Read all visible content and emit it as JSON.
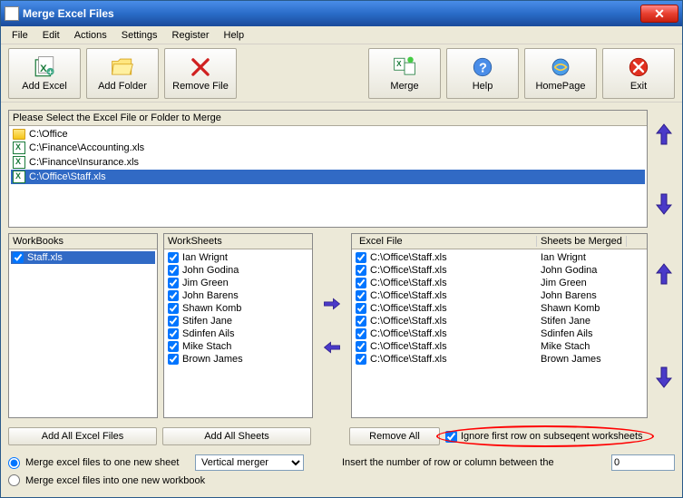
{
  "window": {
    "title": "Merge Excel Files"
  },
  "menu": [
    "File",
    "Edit",
    "Actions",
    "Settings",
    "Register",
    "Help"
  ],
  "toolbar": [
    {
      "id": "add-excel",
      "label": "Add Excel"
    },
    {
      "id": "add-folder",
      "label": "Add Folder"
    },
    {
      "id": "remove-file",
      "label": "Remove File"
    },
    {
      "id": "merge",
      "label": "Merge"
    },
    {
      "id": "help",
      "label": "Help"
    },
    {
      "id": "homepage",
      "label": "HomePage"
    },
    {
      "id": "exit",
      "label": "Exit"
    }
  ],
  "files_panel": {
    "header": "Please Select the Excel File or Folder to Merge",
    "items": [
      {
        "type": "folder",
        "path": "C:\\Office"
      },
      {
        "type": "excel",
        "path": "C:\\Finance\\Accounting.xls"
      },
      {
        "type": "excel",
        "path": "C:\\Finance\\Insurance.xls"
      },
      {
        "type": "excel",
        "path": "C:\\Office\\Staff.xls",
        "selected": true
      }
    ]
  },
  "workbooks": {
    "header": "WorkBooks",
    "items": [
      {
        "name": "Staff.xls",
        "checked": true,
        "selected": true
      }
    ]
  },
  "worksheets": {
    "header": "WorkSheets",
    "items": [
      {
        "name": "Ian Wrignt",
        "checked": true
      },
      {
        "name": "John Godina",
        "checked": true
      },
      {
        "name": "Jim Green",
        "checked": true
      },
      {
        "name": "John Barens",
        "checked": true
      },
      {
        "name": "Shawn Komb",
        "checked": true
      },
      {
        "name": "Stifen Jane",
        "checked": true
      },
      {
        "name": "Sdinfen Ails",
        "checked": true
      },
      {
        "name": "Mike Stach",
        "checked": true
      },
      {
        "name": "Brown James",
        "checked": true
      }
    ]
  },
  "merge_list": {
    "header_file": "Excel File",
    "header_sheets": "Sheets be Merged",
    "rows": [
      {
        "file": "C:\\Office\\Staff.xls",
        "sheet": "Ian Wrignt"
      },
      {
        "file": "C:\\Office\\Staff.xls",
        "sheet": "John Godina"
      },
      {
        "file": "C:\\Office\\Staff.xls",
        "sheet": "Jim Green"
      },
      {
        "file": "C:\\Office\\Staff.xls",
        "sheet": "John Barens"
      },
      {
        "file": "C:\\Office\\Staff.xls",
        "sheet": "Shawn Komb"
      },
      {
        "file": "C:\\Office\\Staff.xls",
        "sheet": "Stifen Jane"
      },
      {
        "file": "C:\\Office\\Staff.xls",
        "sheet": "Sdinfen Ails"
      },
      {
        "file": "C:\\Office\\Staff.xls",
        "sheet": "Mike Stach"
      },
      {
        "file": "C:\\Office\\Staff.xls",
        "sheet": "Brown James"
      }
    ]
  },
  "buttons": {
    "add_all_excel": "Add All Excel Files",
    "add_all_sheets": "Add All Sheets",
    "remove_all": "Remove All"
  },
  "checkbox": {
    "ignore_first_row": "Ignore first row on subseqent worksheets",
    "checked": true
  },
  "options": {
    "merge_one_sheet": "Merge excel files to one new sheet",
    "merge_one_workbook": "Merge excel files into one new workbook",
    "selected": "merge_one_sheet",
    "merge_type_options": [
      "Vertical merger"
    ],
    "merge_type_selected": "Vertical merger",
    "insert_label": "Insert the number of row or column between the",
    "insert_value": "0"
  }
}
